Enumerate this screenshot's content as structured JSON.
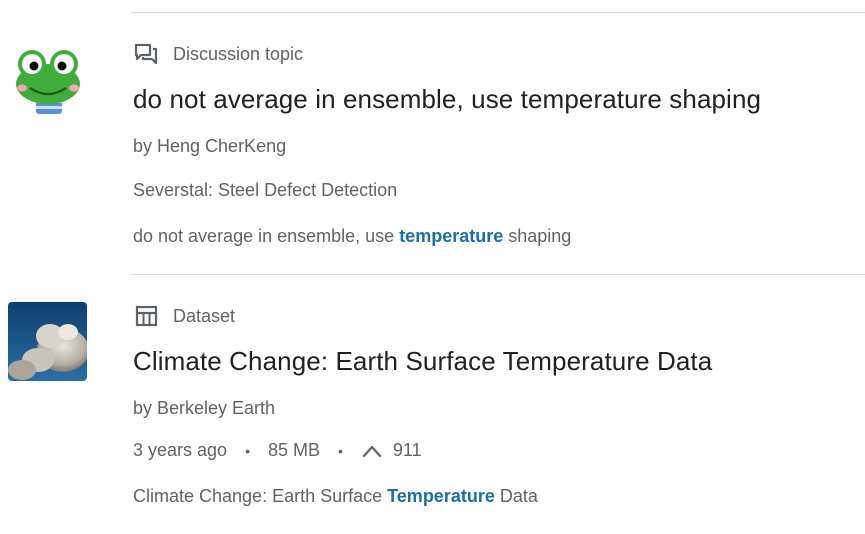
{
  "results": [
    {
      "type_label": "Discussion topic",
      "type_icon": "discussion-icon",
      "title": "do not average in ensemble, use temperature shaping",
      "byline": "by Heng CherKeng",
      "competition": "Severstal: Steel Defect Detection",
      "snippet_before": "do not average in ensemble, use ",
      "snippet_highlight": "temperature",
      "snippet_after": " shaping",
      "thumbnail": "frog-avatar-icon"
    },
    {
      "type_label": "Dataset",
      "type_icon": "dataset-table-icon",
      "title": "Climate Change: Earth Surface Temperature Data",
      "byline": "by Berkeley Earth",
      "age": "3 years ago",
      "size": "85 MB",
      "upvotes": "911",
      "separator": "•",
      "snippet_before": "Climate Change: Earth Surface ",
      "snippet_highlight": "Temperature",
      "snippet_after": " Data",
      "thumbnail": "clouds-sky-image"
    }
  ],
  "colors": {
    "highlight": "#1a6fa8",
    "text_primary": "#202124",
    "text_secondary": "#5f6368",
    "divider": "#dadce0"
  }
}
